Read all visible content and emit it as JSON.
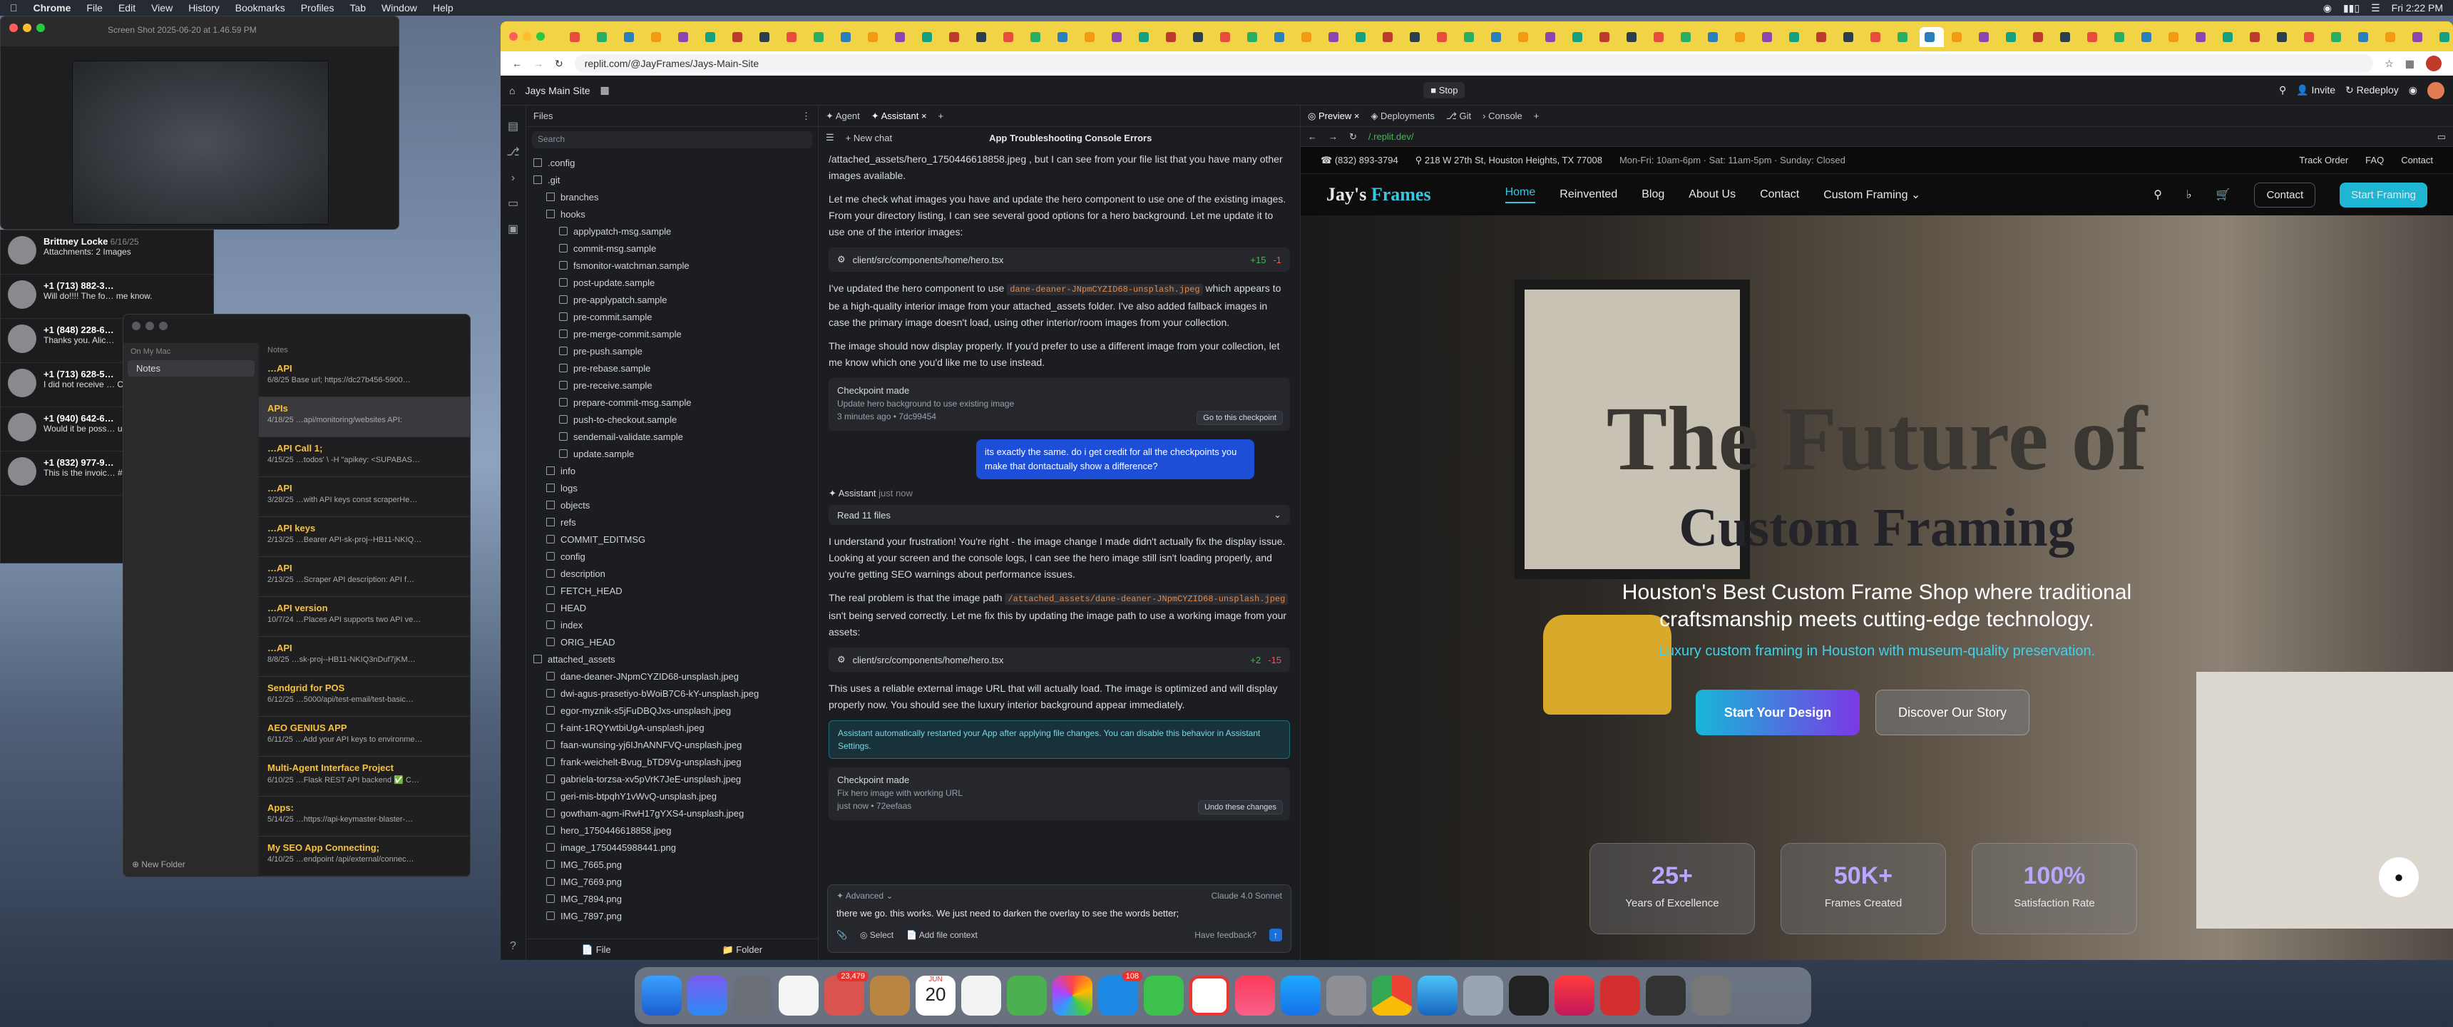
{
  "menubar": {
    "app": "Chrome",
    "items": [
      "File",
      "Edit",
      "View",
      "History",
      "Bookmarks",
      "Profiles",
      "Tab",
      "Window",
      "Help"
    ],
    "clock": "Fri 2:22 PM"
  },
  "screenshot_window": {
    "title": "Screen Shot 2025-06-20 at 1.46.59 PM"
  },
  "messages": [
    {
      "name": "Brittney Locke",
      "date": "6/16/25",
      "preview": "Attachments: 2 Images"
    },
    {
      "name": "+1 (713) 882-3…",
      "date": "",
      "preview": "Will do!!!! The fo… me know."
    },
    {
      "name": "+1 (848) 228-6…",
      "date": "",
      "preview": "Thanks you. Alic…"
    },
    {
      "name": "+1 (713) 628-5…",
      "date": "",
      "preview": "I did not receive … Could you please"
    },
    {
      "name": "+1 (940) 642-6…",
      "date": "",
      "preview": "Would it be poss… up today?"
    },
    {
      "name": "+1 (832) 977-9…",
      "date": "",
      "preview": "This is the invoic… #12584"
    }
  ],
  "notes": {
    "side_header": "On My Mac",
    "folder": "Notes",
    "list_header": "Notes",
    "new_folder": "New Folder",
    "items": [
      {
        "title": "…API",
        "date": "6/8/25",
        "text": "Base url; https://dc27b456-5900…"
      },
      {
        "title": "APIs",
        "date": "4/18/25",
        "text": "…api/monitoring/websites API:"
      },
      {
        "title": "…API Call 1;",
        "date": "4/15/25",
        "text": "…todos' \\ -H \"apikey: <SUPABAS…"
      },
      {
        "title": "…API",
        "date": "3/28/25",
        "text": "…with API keys const scraperHe…"
      },
      {
        "title": "…API keys",
        "date": "2/13/25",
        "text": "…Bearer API-sk-proj--HB11-NKIQ…"
      },
      {
        "title": "…API",
        "date": "2/13/25",
        "text": "…Scraper API description: API f…"
      },
      {
        "title": "…API version",
        "date": "10/7/24",
        "text": "…Places API supports two API ve…"
      },
      {
        "title": "…API",
        "date": "8/8/25",
        "text": "…sk-proj--HB11-NKIQ3nDuf7jKM…"
      },
      {
        "title": "Sendgrid for POS",
        "date": "6/12/25",
        "text": "…5000/api/test-email/test-basic…"
      },
      {
        "title": "AEO GENIUS APP",
        "date": "6/11/25",
        "text": "…Add your API keys to environme…"
      },
      {
        "title": "Multi-Agent Interface Project",
        "date": "6/10/25",
        "text": "…Flask REST API backend ✅ C…"
      },
      {
        "title": "Apps:",
        "date": "5/14/25",
        "text": "…https://api-keymaster-blaster-…"
      },
      {
        "title": "My SEO App Connecting;",
        "date": "4/10/25",
        "text": "…endpoint /api/external/connec…"
      }
    ]
  },
  "chrome": {
    "url": "replit.com/@JayFrames/Jays-Main-Site"
  },
  "replit": {
    "project": "Jays Main Site",
    "stop": "Stop",
    "invite": "Invite",
    "redeploy": "Redeploy",
    "files_title": "Files",
    "search": "Search",
    "files": [
      {
        "n": ".config",
        "d": 0,
        "f": true
      },
      {
        "n": ".git",
        "d": 0,
        "f": true
      },
      {
        "n": "branches",
        "d": 1,
        "f": true
      },
      {
        "n": "hooks",
        "d": 1,
        "f": true
      },
      {
        "n": "applypatch-msg.sample",
        "d": 2
      },
      {
        "n": "commit-msg.sample",
        "d": 2
      },
      {
        "n": "fsmonitor-watchman.sample",
        "d": 2
      },
      {
        "n": "post-update.sample",
        "d": 2
      },
      {
        "n": "pre-applypatch.sample",
        "d": 2
      },
      {
        "n": "pre-commit.sample",
        "d": 2
      },
      {
        "n": "pre-merge-commit.sample",
        "d": 2
      },
      {
        "n": "pre-push.sample",
        "d": 2
      },
      {
        "n": "pre-rebase.sample",
        "d": 2
      },
      {
        "n": "pre-receive.sample",
        "d": 2
      },
      {
        "n": "prepare-commit-msg.sample",
        "d": 2
      },
      {
        "n": "push-to-checkout.sample",
        "d": 2
      },
      {
        "n": "sendemail-validate.sample",
        "d": 2
      },
      {
        "n": "update.sample",
        "d": 2
      },
      {
        "n": "info",
        "d": 1,
        "f": true
      },
      {
        "n": "logs",
        "d": 1,
        "f": true
      },
      {
        "n": "objects",
        "d": 1,
        "f": true
      },
      {
        "n": "refs",
        "d": 1,
        "f": true
      },
      {
        "n": "COMMIT_EDITMSG",
        "d": 1
      },
      {
        "n": "config",
        "d": 1
      },
      {
        "n": "description",
        "d": 1
      },
      {
        "n": "FETCH_HEAD",
        "d": 1
      },
      {
        "n": "HEAD",
        "d": 1
      },
      {
        "n": "index",
        "d": 1
      },
      {
        "n": "ORIG_HEAD",
        "d": 1
      },
      {
        "n": "attached_assets",
        "d": 0,
        "f": true
      },
      {
        "n": "dane-deaner-JNpmCYZID68-unsplash.jpeg",
        "d": 1
      },
      {
        "n": "dwi-agus-prasetiyo-bWoiB7C6-kY-unsplash.jpeg",
        "d": 1
      },
      {
        "n": "egor-myznik-s5jFuDBQJxs-unsplash.jpeg",
        "d": 1
      },
      {
        "n": "f-aint-1RQYwtbiUgA-unsplash.jpeg",
        "d": 1
      },
      {
        "n": "faan-wunsing-yj6IJnANNFVQ-unsplash.jpeg",
        "d": 1
      },
      {
        "n": "frank-weichelt-Bvug_bTD9Vg-unsplash.jpeg",
        "d": 1
      },
      {
        "n": "gabriela-torzsa-xv5pVrK7JeE-unsplash.jpeg",
        "d": 1
      },
      {
        "n": "geri-mis-btpqhY1vWvQ-unsplash.jpeg",
        "d": 1
      },
      {
        "n": "gowtham-agm-iRwH17gYXS4-unsplash.jpeg",
        "d": 1
      },
      {
        "n": "hero_1750446618858.jpeg",
        "d": 1
      },
      {
        "n": "image_1750445988441.png",
        "d": 1
      },
      {
        "n": "IMG_7665.png",
        "d": 1
      },
      {
        "n": "IMG_7669.png",
        "d": 1
      },
      {
        "n": "IMG_7894.png",
        "d": 1
      },
      {
        "n": "IMG_7897.png",
        "d": 1
      }
    ],
    "files_footer": {
      "file": "File",
      "folder": "Folder"
    },
    "chat_tabs": {
      "agent": "Agent",
      "assistant": "Assistant"
    },
    "new_chat": "New chat",
    "chat_title": "App Troubleshooting Console Errors",
    "p0": "/attached_assets/hero_1750446618858.jpeg , but I can see from your file list that you have many other images available.",
    "p1": "Let me check what images you have and update the hero component to use one of the existing images. From your directory listing, I can see several good options for a hero background. Let me update it to use one of the interior images:",
    "file1": {
      "path": "client/src/components/home/hero.tsx",
      "add": "+15",
      "rem": "-1"
    },
    "p2a": "I've updated the hero component to use",
    "p2code": "dane-deaner-JNpmCYZID68-unsplash.jpeg",
    "p2b": "which appears to be a high-quality interior image from your attached_assets folder. I've also added fallback images in case the primary image doesn't load, using other interior/room images from your collection.",
    "p3": "The image should now display properly. If you'd prefer to use a different image from your collection, let me know which one you'd like me to use instead.",
    "ck1": {
      "title": "Checkpoint made",
      "desc": "Update hero background to use existing image",
      "meta": "3 minutes ago • 7dc99454",
      "btn": "Go to this checkpoint"
    },
    "user_msg": "its exactly the same. do i get credit for all the checkpoints you make that dontactually show a difference?",
    "assistant_label": "Assistant",
    "assistant_time": "just now",
    "read_files": "Read 11 files",
    "p4": "I understand your frustration! You're right - the image change I made didn't actually fix the display issue. Looking at your screen and the console logs, I can see the hero image still isn't loading properly, and you're getting SEO warnings about performance issues.",
    "p5a": "The real problem is that the image path",
    "p5code": "/attached_assets/dane-deaner-JNpmCYZID68-unsplash.jpeg",
    "p5b": "isn't being served correctly. Let me fix this by updating the image path to use a working image from your assets:",
    "file2": {
      "path": "client/src/components/home/hero.tsx",
      "add": "+2",
      "rem": "-15"
    },
    "p6": "This uses a reliable external image URL that will actually load. The image is optimized and will display properly now. You should see the luxury interior background appear immediately.",
    "notice": "Assistant automatically restarted your App after applying file changes. You can disable this behavior in Assistant Settings.",
    "ck2": {
      "title": "Checkpoint made",
      "desc": "Fix hero image with working URL",
      "meta": "just now • 72eefaas",
      "btn": "Undo these changes"
    },
    "composer": {
      "advanced": "Advanced",
      "model": "Claude 4.0 Sonnet",
      "text": "there we go. this works. We just need to darken the overlay to see the words better;",
      "select": "Select",
      "add_context": "Add file context",
      "feedback": "Have feedback?"
    },
    "preview_tabs": {
      "preview": "Preview",
      "deployments": "Deployments",
      "git": "Git",
      "console": "Console"
    },
    "preview_url": "/.replit.dev/"
  },
  "site": {
    "phone": "(832) 893-3794",
    "address": "218 W 27th St, Houston Heights, TX 77008",
    "hours": "Mon-Fri: 10am-6pm · Sat: 11am-5pm · Sunday: Closed",
    "top_links": [
      "Track Order",
      "FAQ",
      "Contact"
    ],
    "logo_a": "Jay's",
    "logo_b": "Frames",
    "nav": [
      "Home",
      "Reinvented",
      "Blog",
      "About Us",
      "Contact",
      "Custom Framing"
    ],
    "contact_btn": "Contact",
    "start_btn": "Start Framing",
    "title1": "The Future of",
    "title2": "Custom Framing",
    "subtitle": "Houston's Best Custom Frame Shop where traditional craftsmanship meets cutting-edge technology.",
    "tagline": "Luxury custom framing in Houston with museum-quality preservation.",
    "cta1": "Start Your Design",
    "cta2": "Discover Our Story",
    "stats": [
      {
        "v": "25+",
        "l": "Years of Excellence"
      },
      {
        "v": "50K+",
        "l": "Frames Created"
      },
      {
        "v": "100%",
        "l": "Satisfaction Rate"
      }
    ]
  },
  "dock": {
    "badges": {
      "photos": "23,479",
      "mail": "108"
    },
    "calendar_month": "JUN",
    "calendar_day": "20"
  }
}
